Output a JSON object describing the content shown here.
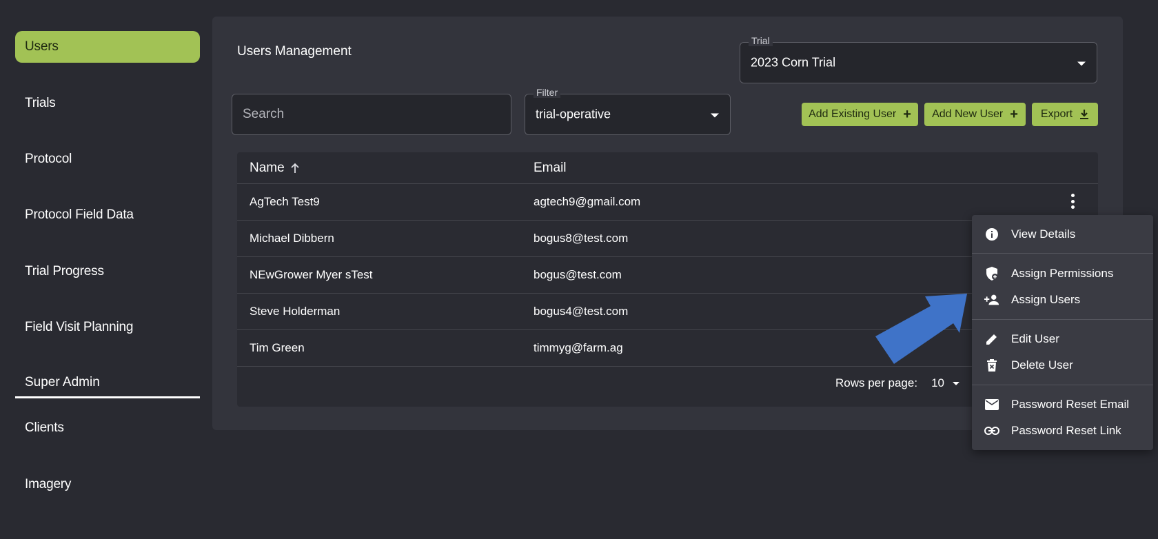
{
  "sidebar": {
    "items": [
      {
        "label": "Users",
        "active": true
      },
      {
        "label": "Trials"
      },
      {
        "label": "Protocol"
      },
      {
        "label": "Protocol Field Data"
      },
      {
        "label": "Trial Progress"
      },
      {
        "label": "Field Visit Planning"
      }
    ],
    "section_label": "Super Admin",
    "admin_items": [
      {
        "label": "Clients"
      },
      {
        "label": "Imagery"
      }
    ]
  },
  "main": {
    "title": "Users Management",
    "trial_select": {
      "legend": "Trial",
      "value": "2023 Corn Trial"
    },
    "search": {
      "placeholder": "Search"
    },
    "filter_select": {
      "legend": "Filter",
      "value": "trial-operative"
    },
    "buttons": {
      "add_existing": "Add Existing User",
      "add_new": "Add New User",
      "export": "Export"
    },
    "table": {
      "columns": {
        "name": "Name",
        "email": "Email"
      },
      "rows": [
        {
          "name": "AgTech Test9",
          "email": "agtech9@gmail.com"
        },
        {
          "name": "Michael Dibbern",
          "email": "bogus8@test.com"
        },
        {
          "name": "NEwGrower Myer sTest",
          "email": "bogus@test.com"
        },
        {
          "name": "Steve Holderman",
          "email": "bogus4@test.com"
        },
        {
          "name": "Tim Green",
          "email": "timmyg@farm.ag"
        }
      ],
      "rows_per_page_label": "Rows per page:",
      "rows_per_page_value": "10"
    }
  },
  "context_menu": {
    "items": [
      {
        "label": "View Details",
        "icon": "info-icon"
      },
      {
        "label": "Assign Permissions",
        "icon": "shield-add-icon"
      },
      {
        "label": "Assign Users",
        "icon": "person-add-icon"
      },
      {
        "label": "Edit User",
        "icon": "pencil-icon"
      },
      {
        "label": "Delete User",
        "icon": "trash-icon"
      },
      {
        "label": "Password Reset Email",
        "icon": "mail-icon"
      },
      {
        "label": "Password Reset Link",
        "icon": "link-icon"
      }
    ]
  },
  "colors": {
    "accent": "#a2c255",
    "background": "#292a31",
    "panel": "#33343c",
    "arrow": "#3f73c8"
  }
}
